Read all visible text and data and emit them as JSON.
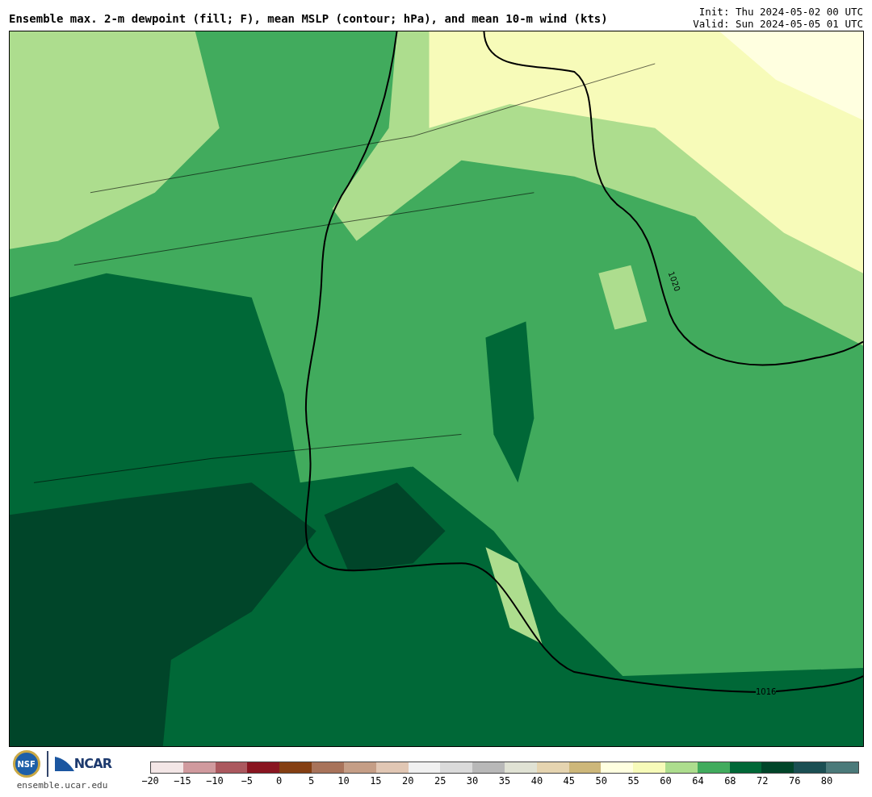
{
  "title": "Ensemble max. 2-m dewpoint (fill; F), mean MSLP (contour; hPa), and mean 10-m wind (kts)",
  "init": "Init: Thu 2024-05-02 00 UTC",
  "valid": "Valid: Sun 2024-05-05 01 UTC",
  "map": {
    "contour_labels": [
      "1020",
      "1016"
    ]
  },
  "logos": {
    "nsf": "NSF",
    "ncar": "NCAR",
    "site": "ensemble.ucar.edu"
  },
  "colorbar": {
    "segments": [
      {
        "color": "#f3e6e6"
      },
      {
        "color": "#d09a9e"
      },
      {
        "color": "#ab585e"
      },
      {
        "color": "#891520"
      },
      {
        "color": "#843f12"
      },
      {
        "color": "#a8735a"
      },
      {
        "color": "#c59e86"
      },
      {
        "color": "#e1c7b4"
      },
      {
        "color": "#f0f0f0"
      },
      {
        "color": "#dadada"
      },
      {
        "color": "#b8b8b8"
      },
      {
        "color": "#e0e2d4"
      },
      {
        "color": "#e5d4b0"
      },
      {
        "color": "#cdb77a"
      },
      {
        "color": "#ffffe0"
      },
      {
        "color": "#f7fbb9"
      },
      {
        "color": "#addd8e"
      },
      {
        "color": "#41ab5d"
      },
      {
        "color": "#006837"
      },
      {
        "color": "#004529"
      },
      {
        "color": "#1b4f53"
      },
      {
        "color": "#4b7a7a"
      }
    ],
    "ticks": [
      "−20",
      "−15",
      "−10",
      "−5",
      "0",
      "5",
      "10",
      "15",
      "20",
      "25",
      "30",
      "35",
      "40",
      "45",
      "50",
      "55",
      "60",
      "64",
      "68",
      "72",
      "76",
      "80"
    ]
  }
}
